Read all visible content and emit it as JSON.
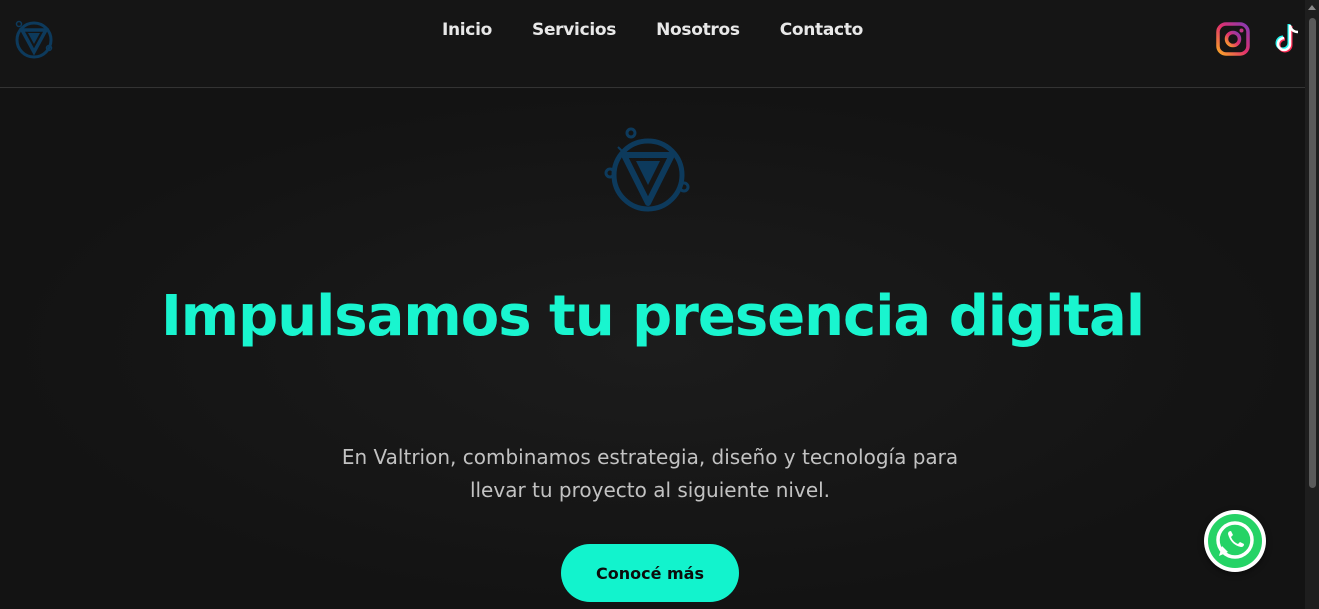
{
  "nav": {
    "items": [
      "Inicio",
      "Servicios",
      "Nosotros",
      "Contacto"
    ]
  },
  "hero": {
    "headline": "Impulsamos tu presencia digital",
    "subtitle": "En Valtrion, combinamos estrategia, diseño y tecnología para llevar tu proyecto al siguiente nivel.",
    "cta_label": "Conocé más"
  },
  "icons": {
    "brand": "valtrion-logo-icon",
    "instagram": "instagram-icon",
    "tiktok": "tiktok-icon",
    "whatsapp": "whatsapp-icon"
  },
  "colors": {
    "background": "#141414",
    "accent": "#19f5cf",
    "logo_blue": "#0d3a5c",
    "whatsapp_green": "#25d366"
  }
}
